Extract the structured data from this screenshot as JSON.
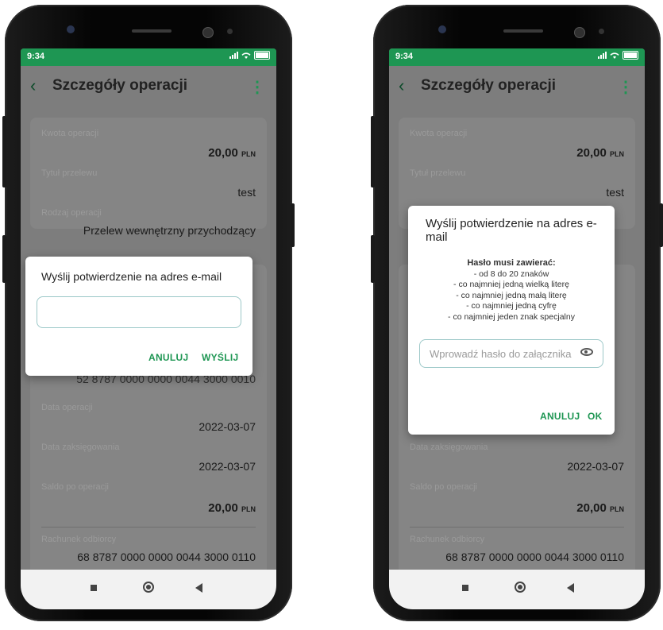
{
  "phone1": {
    "status": {
      "time": "9:34"
    },
    "appbar": {
      "title": "Szczegóły operacji"
    },
    "card1": {
      "amount_label": "Kwota operacji",
      "amount_value": "20,00",
      "amount_currency": "PLN",
      "title_label": "Tytuł przelewu",
      "title_value": "test",
      "type_label": "Rodzaj operacji",
      "type_value": "Przelew wewnętrzny przychodzący"
    },
    "card2": {
      "partial_account": "52 8787 0000 0000 0044 3000 0010",
      "op_date_label": "Data operacji",
      "op_date_value": "2022-03-07",
      "book_date_label": "Data zaksięgowania",
      "book_date_value": "2022-03-07",
      "balance_label": "Saldo po operacji",
      "balance_value": "20,00",
      "balance_currency": "PLN",
      "recipient_label": "Rachunek odbiorcy",
      "recipient_value": "68 8787 0000 0000 0044 3000 0110"
    },
    "dialog": {
      "title": "Wyślij potwierdzenie na adres e-mail",
      "input_value": "",
      "cancel_label": "ANULUJ",
      "send_label": "WYŚLIJ"
    }
  },
  "phone2": {
    "status": {
      "time": "9:34"
    },
    "appbar": {
      "title": "Szczegóły operacji"
    },
    "card1": {
      "amount_label": "Kwota operacji",
      "amount_value": "20,00",
      "amount_currency": "PLN",
      "title_label": "Tytuł przelewu",
      "title_value": "test"
    },
    "card2": {
      "book_date_label": "Data zaksięgowania",
      "book_date_value": "2022-03-07",
      "balance_label": "Saldo po operacji",
      "balance_value": "20,00",
      "balance_currency": "PLN",
      "recipient_label": "Rachunek odbiorcy",
      "recipient_value": "68 8787 0000 0000 0044 3000 0110"
    },
    "dialog": {
      "title": "Wyślij potwierdzenie na adres e-mail",
      "requirements_head": "Hasło musi zawierać:",
      "requirements": [
        "- od 8 do 20 znaków",
        "- co najmniej jedną wielką literę",
        "- co najmniej jedną małą literę",
        "- co najmniej jedną cyfrę",
        "- co najmniej jeden znak specjalny"
      ],
      "password_placeholder": "Wprowadź hasło do załącznika",
      "cancel_label": "ANULUJ",
      "ok_label": "OK"
    }
  },
  "icons": {
    "back": "chevron-left-icon",
    "menu": "kebab-menu-icon",
    "visibility": "eye-icon",
    "nav_recent": "square-icon",
    "nav_home": "circle-icon",
    "nav_back": "triangle-back-icon"
  },
  "colors": {
    "accent": "#1e9653",
    "dim_bg": "#7d7d7d",
    "dialog_bg": "#ffffff"
  }
}
